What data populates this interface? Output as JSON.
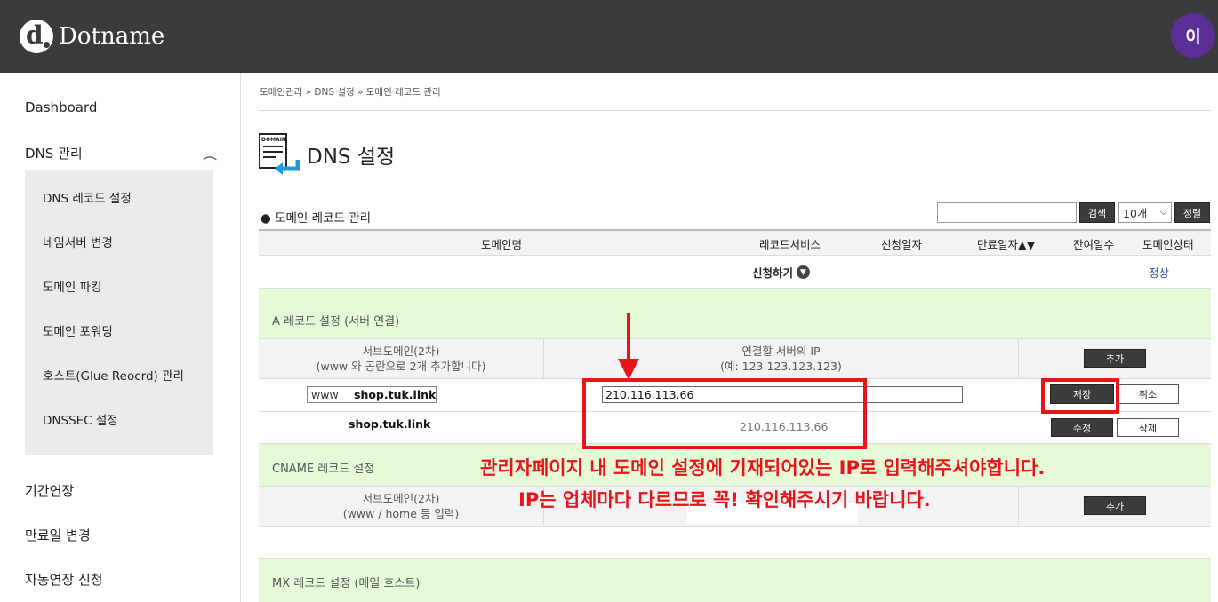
{
  "header": {
    "logo_text": "Dotname",
    "avatar_text": "이"
  },
  "sidebar": {
    "dashboard": "Dashboard",
    "dns_mgmt": "DNS 관리",
    "submenu": [
      "DNS 레코드 설정",
      "네임서버 변경",
      "도메인 파킹",
      "도메인 포워딩",
      "호스트(Glue Reocrd) 관리",
      "DNSSEC 설정"
    ],
    "extend": "기간연장",
    "expire_change": "만료일 변경",
    "auto_renew": "자동연장 신청"
  },
  "breadcrumb": "도메인관리 » DNS 설정 » 도메인 레코드 관리",
  "page_title": "DNS 설정",
  "title_icon_label": "DOMAIN",
  "records": {
    "section_label": "도메인 레코드 관리",
    "search_button": "검색",
    "page_size": "10개",
    "sort_button": "정렬",
    "columns": [
      "도메인명",
      "레코드서비스",
      "신청일자",
      "만료일자▲▼",
      "잔여일수",
      "도메인상태"
    ],
    "apply_label": "신청하기",
    "status": "정상"
  },
  "a_record": {
    "title": "A 레코드 설정 (서버 연결)",
    "col_sub_line1": "서브도메인(2차)",
    "col_sub_line2": "(www 와 공란으로 2개 추가합니다)",
    "col_ip_line1": "연결할 서버의 IP",
    "col_ip_line2": "(예: 123.123.123.123)",
    "add_button": "추가",
    "input_subdomain": "www",
    "input_domain": "shop.tuk.link",
    "input_ip": "210.116.113.66",
    "save_button": "저장",
    "cancel_button": "취소",
    "existing_domain": "shop.tuk.link",
    "existing_ip": "210.116.113.66",
    "edit_button": "수정",
    "delete_button": "삭제"
  },
  "cname_record": {
    "title": "CNAME 레코드 설정",
    "col_sub_line1": "서브도메인(2차)",
    "col_sub_line2": "(www / home 등 입력)",
    "add_button": "추가"
  },
  "mx_record": {
    "title": "MX 레코드 설정 (메일 호스트)"
  },
  "annotation": {
    "line1": "관리자페이지 내 도메인 설정에 기재되어있는 IP로 입력해주셔야합니다.",
    "line2": "IP는 업체마다 다르므로 꼭! 확인해주시기 바랍니다.",
    "color": "#e8141a"
  }
}
